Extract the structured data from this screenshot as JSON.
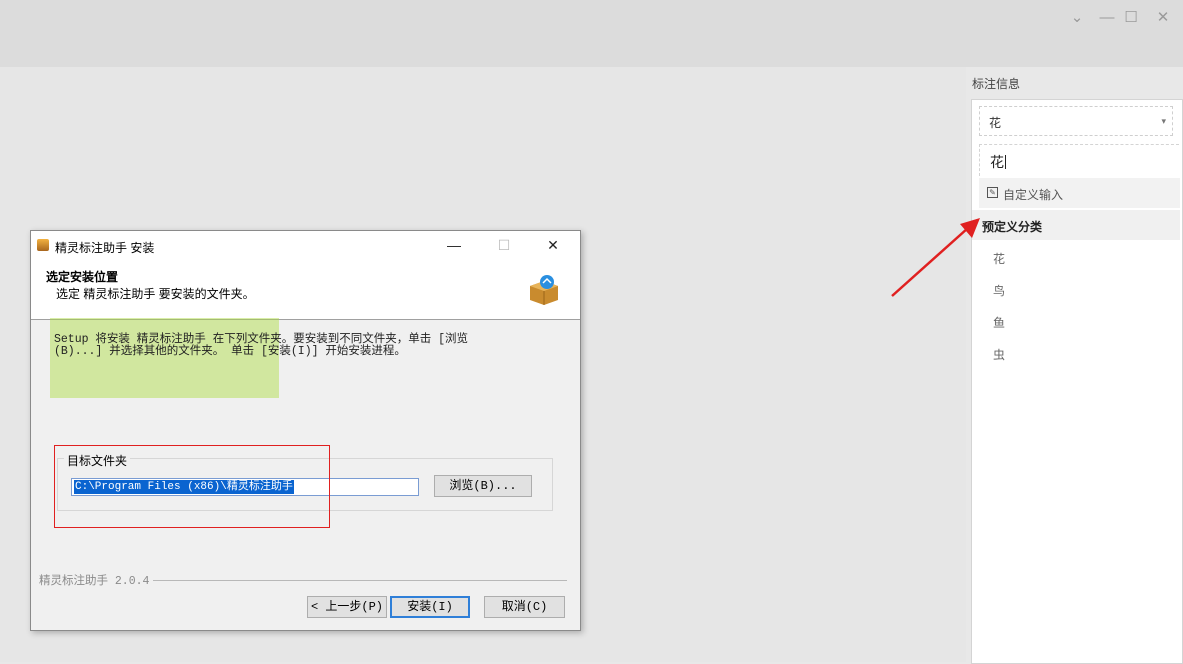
{
  "window_controls": {
    "dropdown": "⌄",
    "minimize": "—",
    "maximize": "☐",
    "close": "✕"
  },
  "panel": {
    "title": "标注信息",
    "select_value": "花",
    "select_arrow": "▾",
    "search_value": "花",
    "custom_input_label": "自定义输入",
    "group_label": "预定义分类",
    "options": [
      "花",
      "鸟",
      "鱼",
      "虫"
    ]
  },
  "dialog": {
    "title": "精灵标注助手 安装",
    "controls": {
      "minimize": "—",
      "maximize": "☐",
      "close": "✕"
    },
    "heading": "选定安装位置",
    "subheading": "选定 精灵标注助手 要安装的文件夹。",
    "description_line1": "Setup 将安装 精灵标注助手 在下列文件夹。要安装到不同文件夹，单击 [浏览",
    "description_line2": "(B)...] 并选择其他的文件夹。 单击 [安装(I)] 开始安装进程。",
    "group_title": "目标文件夹",
    "path_value": "C:\\Program Files (x86)\\精灵标注助手",
    "browse_label": "浏览(B)...",
    "brand": "精灵标注助手 2.0.4",
    "back_label": "< 上一步(P)",
    "install_label": "安装(I)",
    "cancel_label": "取消(C)"
  },
  "colors": {
    "annotation_red": "#e02020",
    "annotation_green": "#aadc3c",
    "selection_blue": "#0a64d0"
  }
}
